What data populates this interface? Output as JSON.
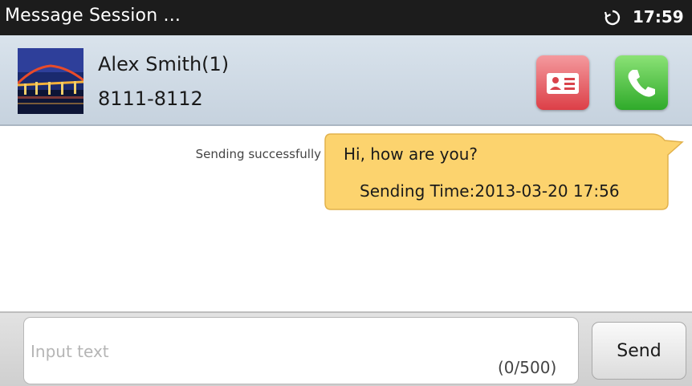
{
  "status_bar": {
    "title": "Message Session ...",
    "time": "17:59",
    "sync_icon": "sync-icon"
  },
  "contact": {
    "name": "Alex Smith(1)",
    "number": "8111-8112",
    "avatar": "bridge-photo",
    "actions": {
      "contact_card_icon": "contact-card-icon",
      "call_icon": "phone-icon"
    }
  },
  "messages": [
    {
      "status": "Sending successfully",
      "text": "Hi, how are you?",
      "time": "Sending Time:2013-03-20 17:56",
      "bubble_color": "#fcd36e"
    }
  ],
  "composer": {
    "placeholder": "Input text",
    "counter": "(0/500)",
    "send_label": "Send"
  },
  "colors": {
    "status_bar": "#1c1c1c",
    "header": "#cfd9e3",
    "card_button": "#e04a52",
    "call_button": "#39b232"
  }
}
